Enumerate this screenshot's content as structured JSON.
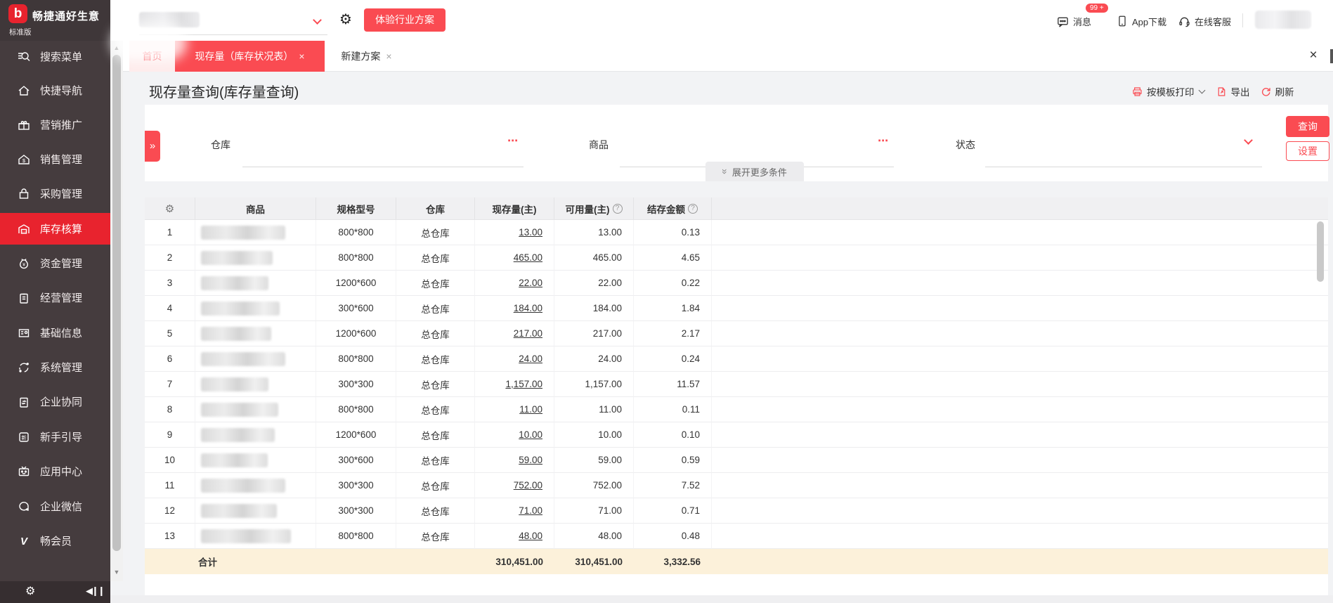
{
  "brand": {
    "name": "畅捷通好生意",
    "edition": "标准版"
  },
  "topbar": {
    "experience_button": "体验行业方案",
    "messages_label": "消息",
    "messages_badge": "99 +",
    "app_download_label": "App下载",
    "online_service_label": "在线客服"
  },
  "tabs": {
    "home": "首页",
    "active_tab": "现存量（库存状况表）",
    "new_plan": "新建方案"
  },
  "sidebar": {
    "items": [
      {
        "label": "搜索菜单",
        "icon": "search-icon",
        "active": false
      },
      {
        "label": "快捷导航",
        "icon": "home-icon",
        "active": false
      },
      {
        "label": "营销推广",
        "icon": "gift-icon",
        "active": false
      },
      {
        "label": "销售管理",
        "icon": "sales-icon",
        "active": false
      },
      {
        "label": "采购管理",
        "icon": "purchase-icon",
        "active": false
      },
      {
        "label": "库存核算",
        "icon": "inventory-icon",
        "active": true
      },
      {
        "label": "资金管理",
        "icon": "funds-icon",
        "active": false
      },
      {
        "label": "经营管理",
        "icon": "operation-icon",
        "active": false
      },
      {
        "label": "基础信息",
        "icon": "basic-info-icon",
        "active": false
      },
      {
        "label": "系统管理",
        "icon": "system-icon",
        "active": false
      },
      {
        "label": "企业协同",
        "icon": "collaboration-icon",
        "active": false
      },
      {
        "label": "新手引导",
        "icon": "guide-icon",
        "active": false
      },
      {
        "label": "应用中心",
        "icon": "app-center-icon",
        "active": false
      },
      {
        "label": "企业微信",
        "icon": "wechat-icon",
        "active": false
      },
      {
        "label": "畅会员",
        "icon": "member-icon",
        "active": false
      }
    ]
  },
  "page": {
    "title": "现存量查询(库存量查询)",
    "print_button": "按模板打印",
    "export_button": "导出",
    "refresh_button": "刷新"
  },
  "filters": {
    "warehouse_label": "仓库",
    "goods_label": "商品",
    "status_label": "状态",
    "expand_more_label": "展开更多条件",
    "query_button": "查询",
    "settings_button": "设置"
  },
  "table": {
    "columns": {
      "goods": "商品",
      "spec": "规格型号",
      "warehouse": "仓库",
      "qty": "现存量(主)",
      "available": "可用量(主)",
      "amount": "结存金额"
    },
    "rows": [
      {
        "num": "1",
        "spec": "800*800",
        "warehouse": "总仓库",
        "qty": "13.00",
        "available": "13.00",
        "amount": "0.13"
      },
      {
        "num": "2",
        "spec": "800*800",
        "warehouse": "总仓库",
        "qty": "465.00",
        "available": "465.00",
        "amount": "4.65"
      },
      {
        "num": "3",
        "spec": "1200*600",
        "warehouse": "总仓库",
        "qty": "22.00",
        "available": "22.00",
        "amount": "0.22"
      },
      {
        "num": "4",
        "spec": "300*600",
        "warehouse": "总仓库",
        "qty": "184.00",
        "available": "184.00",
        "amount": "1.84"
      },
      {
        "num": "5",
        "spec": "1200*600",
        "warehouse": "总仓库",
        "qty": "217.00",
        "available": "217.00",
        "amount": "2.17"
      },
      {
        "num": "6",
        "spec": "800*800",
        "warehouse": "总仓库",
        "qty": "24.00",
        "available": "24.00",
        "amount": "0.24"
      },
      {
        "num": "7",
        "spec": "300*300",
        "warehouse": "总仓库",
        "qty": "1,157.00",
        "available": "1,157.00",
        "amount": "11.57"
      },
      {
        "num": "8",
        "spec": "800*800",
        "warehouse": "总仓库",
        "qty": "11.00",
        "available": "11.00",
        "amount": "0.11"
      },
      {
        "num": "9",
        "spec": "1200*600",
        "warehouse": "总仓库",
        "qty": "10.00",
        "available": "10.00",
        "amount": "0.10"
      },
      {
        "num": "10",
        "spec": "300*600",
        "warehouse": "总仓库",
        "qty": "59.00",
        "available": "59.00",
        "amount": "0.59"
      },
      {
        "num": "11",
        "spec": "300*300",
        "warehouse": "总仓库",
        "qty": "752.00",
        "available": "752.00",
        "amount": "7.52"
      },
      {
        "num": "12",
        "spec": "300*300",
        "warehouse": "总仓库",
        "qty": "71.00",
        "available": "71.00",
        "amount": "0.71"
      },
      {
        "num": "13",
        "spec": "800*800",
        "warehouse": "总仓库",
        "qty": "48.00",
        "available": "48.00",
        "amount": "0.48"
      }
    ],
    "total": {
      "label": "合计",
      "qty": "310,451.00",
      "available": "310,451.00",
      "amount": "3,332.56"
    }
  },
  "colors": {
    "accent": "#fa4b52",
    "sidebar_active": "#e8232e",
    "total_row_bg": "#fcf1da"
  }
}
